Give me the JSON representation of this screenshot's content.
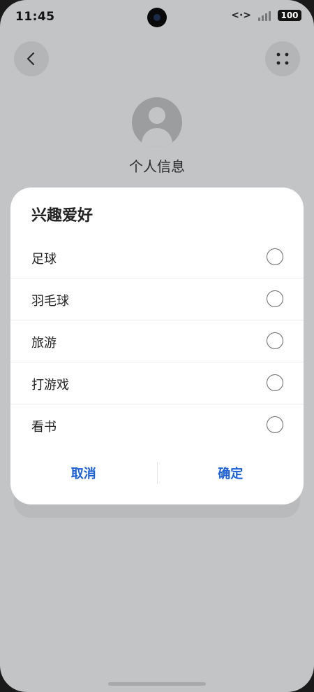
{
  "status_bar": {
    "time": "11:45",
    "battery": "100",
    "net_symbol": "<·>"
  },
  "page": {
    "title": "个人信息"
  },
  "dialog": {
    "title": "兴趣爱好",
    "options": [
      {
        "label": "足球",
        "selected": false
      },
      {
        "label": "羽毛球",
        "selected": false
      },
      {
        "label": "旅游",
        "selected": false
      },
      {
        "label": "打游戏",
        "selected": false
      },
      {
        "label": "看书",
        "selected": false
      }
    ],
    "cancel_label": "取消",
    "confirm_label": "确定"
  },
  "icons": {
    "back": "chevron-left-icon",
    "more": "grid-dots-icon",
    "avatar": "user-avatar-icon"
  },
  "colors": {
    "accent": "#1a5fd6",
    "background": "#c3c4c6",
    "dialog": "#ffffff"
  }
}
